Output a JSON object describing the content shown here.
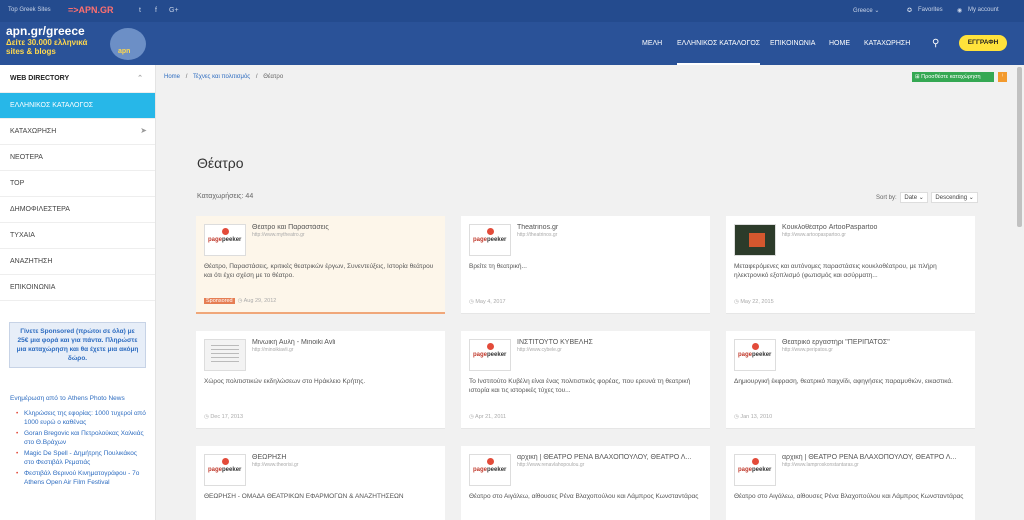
{
  "topbar": {
    "left_text": "Top Greek Sites",
    "apn": "=>APN.GR",
    "social": [
      "t",
      "f",
      "G+"
    ],
    "region": "Greece ⌄",
    "favorites": "Favorites",
    "account": "My account"
  },
  "logo": {
    "line1": "apn.gr/greece",
    "line2": "Δείτε 30.000 ελληνικά",
    "line3": "sites & blogs",
    "badge": "apn"
  },
  "nav": {
    "items": [
      "ΜΕΛΗ",
      "ΕΛΛΗΝΙΚΟΣ ΚΑΤΑΛΟΓΟΣ",
      "ΕΠΙΚΟΙΝΩΝΙΑ",
      "HOME",
      "ΚΑΤΑΧΩΡΗΣΗ"
    ],
    "register": "ΕΓΓΡΑΦΗ"
  },
  "sidebar": {
    "title": "WEB DIRECTORY",
    "items": [
      "ΕΛΛΗΝΙΚΟΣ ΚΑΤΑΛΟΓΟΣ",
      "ΚΑΤΑΧΩΡΗΣΗ",
      "ΝΕΟΤΕΡΑ",
      "TOP",
      "ΔΗΜΟΦΙΛΕΣΤΕΡΑ",
      "ΤΥΧΑΙΑ",
      "ΑΝΑΖΗΤΗΣΗ",
      "ΕΠΙΚΟΙΝΩΝΙΑ"
    ],
    "promo": "Γίνετε Sponsored (πρώτοι σε όλα) με 25€ μια φορά και για πάντα. Πληρώστε μια καταχώρηση και θα έχετε μια ακόμη δώρο.",
    "news_title": "Ενημέρωση από το Athens Photo News",
    "news": [
      "Κληρώσεις της εφορίας: 1000 τυχεροί από 1000 ευρώ ο καθένας",
      "Goran Bregovic και Πετρολούκας Χαλκιάς στο Θ.Βράχων",
      "Magic De Spell - Δημήτρης Πουλικάκος στο Φεστιβάλ Ρεματιάς",
      "Φεστιβάλ Θερινού Κινηματογράφου - 7ο Athens Open Air Film Festival"
    ]
  },
  "breadcrumb": [
    "Home",
    "/",
    "Τέχνες και πολιτισμός",
    "/",
    "Θέατρο"
  ],
  "add_button": "Προσθέστε καταχώρηση",
  "rss": "⁾",
  "page_title": "Θέατρο",
  "count": "Καταχωρήσεις: 44",
  "sort": {
    "label": "Sort by:",
    "field": "Date ⌄",
    "order": "Descending ⌄"
  },
  "cards": [
    {
      "title": "Θέατρο και Παραστάσεις",
      "url": "http://www.mytheatro.gr",
      "desc": "Θέατρο, Παραστάσεις, κριτικές θεατρικών έργων, Συνεντεύξεις, Ιστορία θεάτρου και ότι έχει σχέση με το θέατρο.",
      "date": "◷ Aug 29, 2012",
      "badge": "Sponsored",
      "thumb": "pp"
    },
    {
      "title": "Theatrinos.gr",
      "url": "http://theatrinos.gr",
      "desc": "Βρείτε τη θεατρική...",
      "date": "◷ May 4, 2017",
      "badge": "",
      "thumb": "pp"
    },
    {
      "title": "Κουκλοθέατρο ArtooPaspartoo",
      "url": "http://www.artoopaspartoo.gr",
      "desc": "Μεταφερόμενες και αυτόνομες παραστάσεις κουκλοθέατρου, με πλήρη ηλεκτρονικό εξοπλισμό (φωτισμός και ασύρματη...",
      "date": "◷ May 22, 2015",
      "badge": "",
      "thumb": "dark"
    },
    {
      "title": "Μινωική Αυλή - Minoiki Avli",
      "url": "http://minoikiavli.gr",
      "desc": "Χώρος πολιτιστικών εκδηλώσεων στο Ηράκλειο Κρήτης.",
      "date": "◷ Dec 17, 2013",
      "badge": "",
      "thumb": "doc"
    },
    {
      "title": "ΙΝΣΤΙΤΟΥΤΟ ΚΥΒΕΛΗΣ",
      "url": "http://www.cybele.gr",
      "desc": "Το Ινστιτούτο Κυβέλη είναι ένας πολιτιστικός φορέας, που ερευνά τη θεατρική ιστορία και τις ιστορικές τύχες του...",
      "date": "◷ Apr 21, 2011",
      "badge": "",
      "thumb": "pp"
    },
    {
      "title": "Θεατρικό εργαστήρι \"ΠΕΡΙΠΑΤΟΣ\"",
      "url": "http://www.peripatos.gr",
      "desc": "Δημιουργική έκφραση, θεατρικό παιχνίδι, αφηγήσεις παραμυθιών, εικαστικά.",
      "date": "◷ Jan 13, 2010",
      "badge": "",
      "thumb": "pp"
    },
    {
      "title": "ΘΕΩΡΗΣΗ",
      "url": "http://www.theorisi.gr",
      "desc": "ΘΕΩΡΗΣΗ - ΟΜΑΔΑ ΘΕΑΤΡΙΚΩΝ ΕΦΑΡΜΟΓΩΝ & ΑΝΑΖΗΤΗΣΕΩΝ",
      "date": "",
      "badge": "",
      "thumb": "pp"
    },
    {
      "title": "αρχική | ΘΕΑΤΡΟ ΡΕΝΑ ΒΛΑΧΟΠΟΥΛΟΥ, ΘΕΑΤΡΟ Λ...",
      "url": "http://www.renavlahopoulou.gr",
      "desc": "Θέατρο στο Αιγάλεω, αίθουσες Ρένα Βλαχοπούλου και Λάμπρος Κωνσταντάρας",
      "date": "",
      "badge": "",
      "thumb": "pp"
    },
    {
      "title": "αρχική | ΘΕΑΤΡΟ ΡΕΝΑ ΒΛΑΧΟΠΟΥΛΟΥ, ΘΕΑΤΡΟ Λ...",
      "url": "http://www.lamproskonstantaras.gr",
      "desc": "Θέατρο στο Αιγάλεω, αίθουσες Ρένα Βλαχοπούλου και Λάμπρος Κωνσταντάρας",
      "date": "",
      "badge": "",
      "thumb": "pp"
    }
  ]
}
